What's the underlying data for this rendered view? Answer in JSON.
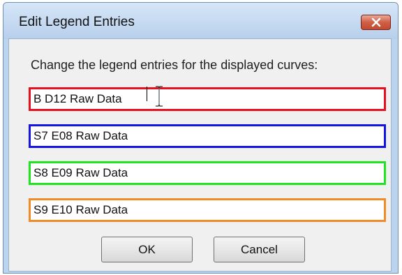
{
  "dialog": {
    "title": "Edit Legend Entries",
    "close_icon": "close-icon",
    "prompt": "Change the legend entries for the displayed curves:",
    "entries": [
      {
        "value": "B D12 Raw Data",
        "border_color": "#e8101e"
      },
      {
        "value": "S7 E08 Raw Data",
        "border_color": "#1414e6"
      },
      {
        "value": "S8 E09 Raw Data",
        "border_color": "#1ee61e"
      },
      {
        "value": "S9 E10 Raw Data",
        "border_color": "#f08c28"
      }
    ],
    "ok_label": "OK",
    "cancel_label": "Cancel"
  }
}
